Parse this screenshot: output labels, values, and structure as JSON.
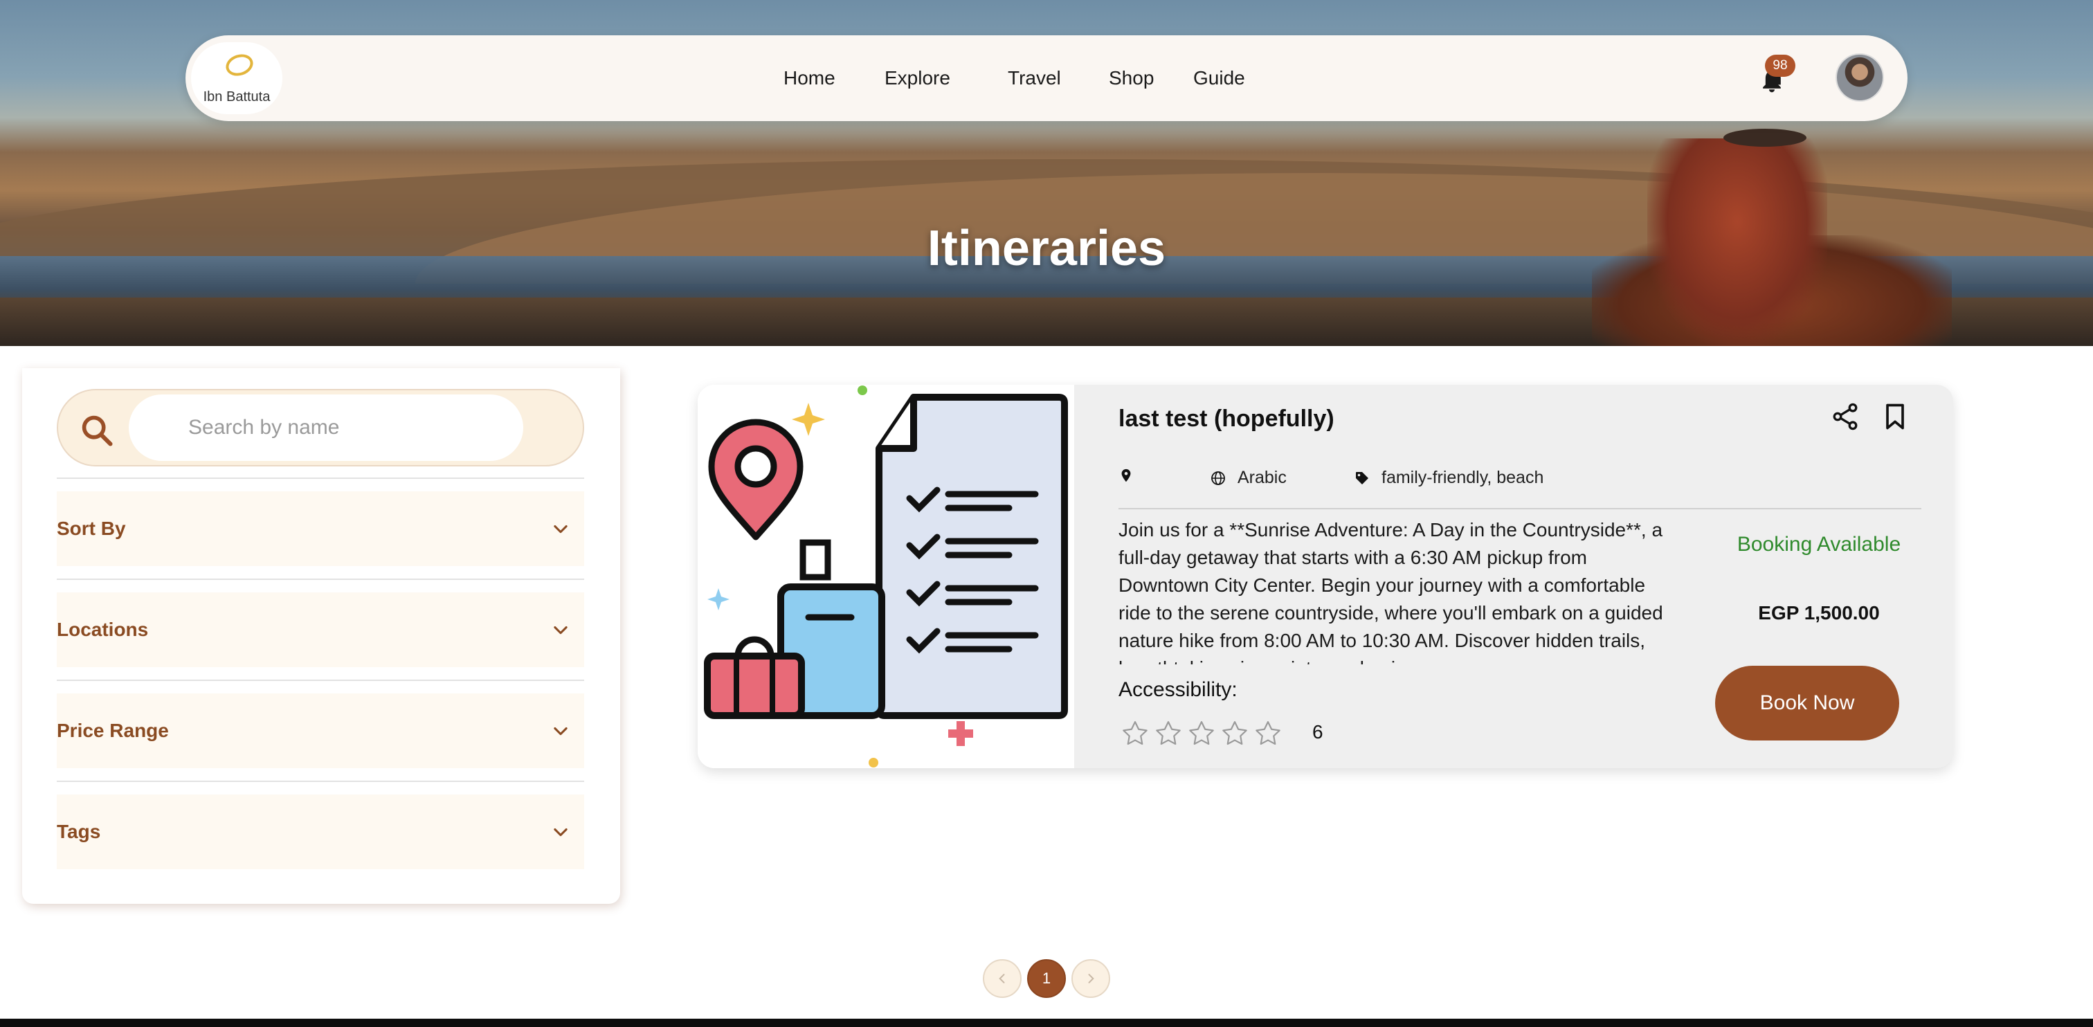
{
  "hero": {
    "title": "Itineraries"
  },
  "nav": {
    "logo_text": "Ibn Battuta",
    "links": [
      "Home",
      "Explore",
      "Travel",
      "Shop",
      "Guide"
    ],
    "notification_count": "98",
    "icons": {
      "bell": "bell-icon",
      "avatar": "user-avatar"
    }
  },
  "sidebar": {
    "search": {
      "placeholder": "Search by name",
      "value": ""
    },
    "filters": [
      "Sort By",
      "Locations",
      "Price Range",
      "Tags"
    ]
  },
  "card": {
    "title": "last test (hopefully)",
    "location": "",
    "language": "Arabic",
    "tags": "family-friendly, beach",
    "description": "Join us for a **Sunrise Adventure: A Day in the Countryside**, a full-day getaway that starts with a 6:30 AM pickup from Downtown City Center. Begin your journey with a comfortable ride to the serene countryside, where you'll embark on a guided nature hike from 8:00 AM to 10:30 AM. Discover hidden trails, breathtaking viewpoints, and unique",
    "accessibility_label": "Accessibility:",
    "rating": {
      "stars_filled": 0,
      "stars_total": 5,
      "count": "6"
    },
    "availability": "Booking Available",
    "price": "EGP 1,500.00",
    "book_label": "Book Now"
  },
  "pagination": {
    "current": "1"
  },
  "colors": {
    "brand_brown": "#9a4f27",
    "available_green": "#2f8a2c",
    "filter_label": "#8a4b22",
    "search_bg": "#fbf0df"
  }
}
